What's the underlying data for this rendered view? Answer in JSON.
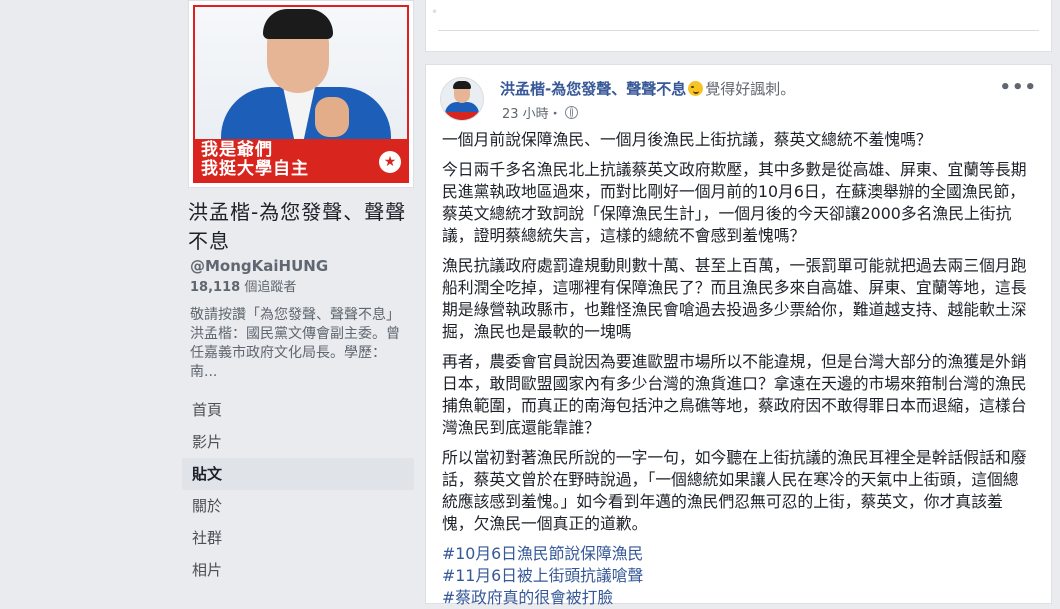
{
  "profile": {
    "slogan_line1": "我是爺們",
    "slogan_line2": "我挺大學自主",
    "name": "洪孟楷-為您發聲、聲聲不息",
    "handle": "@MongKaiHUNG",
    "followers_count": "18,118",
    "followers_label": "個追蹤者",
    "about": "敬請按讚「為您發聲、聲聲不息」洪孟楷：國民黨文傳會副主委。曾任嘉義市政府文化局長。學歷：南..."
  },
  "nav": {
    "items": [
      {
        "label": "首頁"
      },
      {
        "label": "影片"
      },
      {
        "label": "貼文"
      },
      {
        "label": "關於"
      },
      {
        "label": "社群"
      },
      {
        "label": "相片"
      }
    ],
    "active_index": 2
  },
  "post": {
    "author": "洪孟楷-為您發聲、聲聲不息",
    "feeling": "覺得好諷刺。",
    "time": "23 小時・",
    "more_icon": "more-options-icon",
    "paragraphs": [
      "一個月前說保障漁民、一個月後漁民上街抗議，蔡英文總統不羞愧嗎？",
      "今日兩千多名漁民北上抗議蔡英文政府欺壓，其中多數是從高雄、屏東、宜蘭等長期民進黨執政地區過來，而對比剛好一個月前的10月6日，在蘇澳舉辦的全國漁民節，蔡英文總統才致詞說「保障漁民生計」，一個月後的今天卻讓2000多名漁民上街抗議，證明蔡總統失言，這樣的總統不會感到羞愧嗎？",
      "漁民抗議政府處罰違規動則數十萬、甚至上百萬，一張罰單可能就把過去兩三個月跑船利潤全吃掉，這哪裡有保障漁民了？而且漁民多來自高雄、屏東、宜蘭等地，這長期是綠營執政縣市，也難怪漁民會嗆過去投過多少票給你，難道越支持、越能軟土深掘，漁民也是最軟的一塊嗎",
      "再者，農委會官員說因為要進歐盟市場所以不能違規，但是台灣大部分的漁獲是外銷日本，敢問歐盟國家內有多少台灣的漁貨進口？拿遠在天邊的市場來箝制台灣的漁民捕魚範圍，而真正的南海包括沖之鳥礁等地，蔡政府因不敢得罪日本而退縮，這樣台灣漁民到底還能靠誰？",
      "所以當初對著漁民所說的一字一句，如今聽在上街抗議的漁民耳裡全是幹話假話和廢話，蔡英文曾於在野時說過，「一個總統如果讓人民在寒冷的天氣中上街頭，這個總統應該感到羞愧。」如今看到年邁的漁民們忍無可忍的上街，蔡英文，你才真該羞愧，欠漁民一個真正的道歉。"
    ],
    "hashtags": [
      "#10月6日漁民節說保障漁民",
      "#11月6日被上街頭抗議嗆聲",
      "#蔡政府真的很會被打臉"
    ]
  },
  "colors": {
    "background": "#e9ebee",
    "link": "#385898",
    "slogan_red": "#d8261f"
  }
}
